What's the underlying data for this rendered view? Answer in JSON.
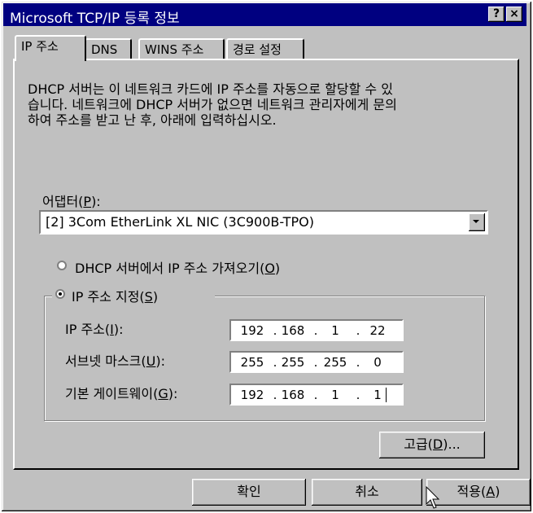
{
  "window": {
    "title": "Microsoft TCP/IP 등록 정보",
    "help_button": "?",
    "close_button": "×"
  },
  "tabs": [
    {
      "label": "IP 주소"
    },
    {
      "label": "DNS"
    },
    {
      "label": "WINS 주소"
    },
    {
      "label": "경로 설정"
    }
  ],
  "description_line1": "DHCP 서버는 이 네트워크 카드에 IP 주소를 자동으로 할당할 수 있",
  "description_line2": "습니다. 네트워크에 DHCP 서버가 없으면 네트워크 관리자에게 문의",
  "description_line3": "하여 주소를 받고 난 후, 아래에 입력하십시오.",
  "adapter": {
    "label_pre": "어댑터(",
    "label_key": "P",
    "label_post": "):",
    "selected": "[2] 3Com EtherLink XL NIC (3C900B-TPO)"
  },
  "radio_dhcp": {
    "label_pre": "DHCP 서버에서 IP 주소 가져오기(",
    "key": "O",
    "label_post": ")",
    "checked": false
  },
  "radio_static": {
    "label_pre": "IP 주소 지정(",
    "key": "S",
    "label_post": ")",
    "checked": true
  },
  "ip": {
    "label_pre": "IP 주소(",
    "key": "I",
    "label_post": "):",
    "octets": [
      "192",
      "168",
      "1",
      "22"
    ]
  },
  "subnet": {
    "label_pre": "서브넷 마스크(",
    "key": "U",
    "label_post": "):",
    "octets": [
      "255",
      "255",
      "255",
      "0"
    ]
  },
  "gateway": {
    "label_pre": "기본 게이트웨이(",
    "key": "G",
    "label_post": "):",
    "octets": [
      "192",
      "168",
      "1",
      "1"
    ]
  },
  "advanced": {
    "pre": "고급(",
    "key": "D",
    "post": ")..."
  },
  "buttons": {
    "ok": "확인",
    "cancel": "취소",
    "apply_pre": "적용(",
    "apply_key": "A",
    "apply_post": ")"
  },
  "sep": "."
}
